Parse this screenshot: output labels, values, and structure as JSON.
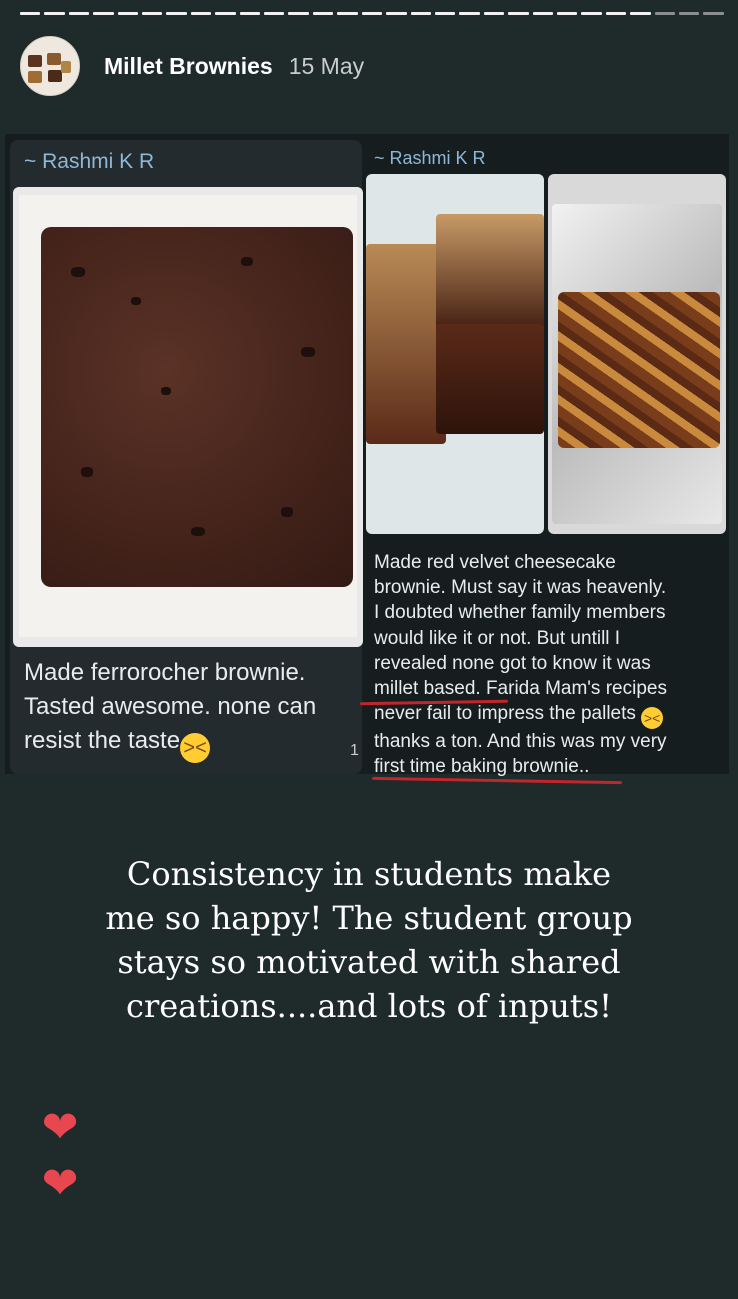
{
  "header": {
    "title": "Millet Brownies",
    "date": "15 May"
  },
  "messages": [
    {
      "sender": "~ Rashmi K R",
      "text_line1": "Made ferrorocher brownie.",
      "text_line2": "Tasted awesome. none can",
      "text_line3": "resist the taste",
      "emoji": "grinning-squinting-face-emoji"
    },
    {
      "sender": "~ Rashmi K R",
      "text": [
        "Made red velvet cheesecake",
        "brownie. Must say it was heavenly.",
        "I doubted whether family members",
        "would like it or not. But untill I",
        "revealed none got to know it was",
        "millet based. Farida Mam's recipes",
        "never fail to impress the pallets",
        "thanks a ton. And this was my very",
        "first time baking brownie.."
      ],
      "emoji": "grinning-squinting-face-emoji"
    }
  ],
  "reaction_count": "1",
  "story_caption": "Consistency in students make me so happy! The student group stays so motivated with shared creations....and lots of inputs!",
  "icons": [
    "heart-icon",
    "heart-icon"
  ],
  "colors": {
    "background": "#1f2a2b",
    "sender": "#8fb7d6",
    "underline": "#c0262b",
    "heart": "#e8474f"
  }
}
